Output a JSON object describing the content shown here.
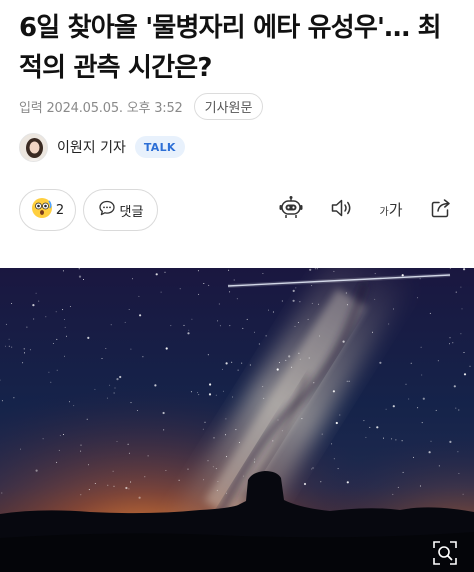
{
  "article": {
    "title": "6일 찾아올 '물병자리 에타 유성우'… 최적의 관측 시간은?",
    "published": "입력 2024.05.05. 오후 3:52",
    "original_label": "기사원문"
  },
  "reporter": {
    "name": "이원지 기자",
    "talk_label": "TALK"
  },
  "actions": {
    "reaction_count": "2",
    "comment_label": "댓글",
    "font_small": "가",
    "font_large": "가"
  },
  "icons": {
    "reaction": "surprised-emoji-icon",
    "comment": "speech-bubble-icon",
    "summary": "robot-icon",
    "listen": "speaker-icon",
    "font": "font-size-icon",
    "share": "share-icon",
    "zoom": "image-zoom-icon"
  },
  "colors": {
    "talk_bg": "#e8f1fc",
    "talk_text": "#2d6fd6",
    "meta_text": "#8a8a8a",
    "border": "#dadada"
  }
}
